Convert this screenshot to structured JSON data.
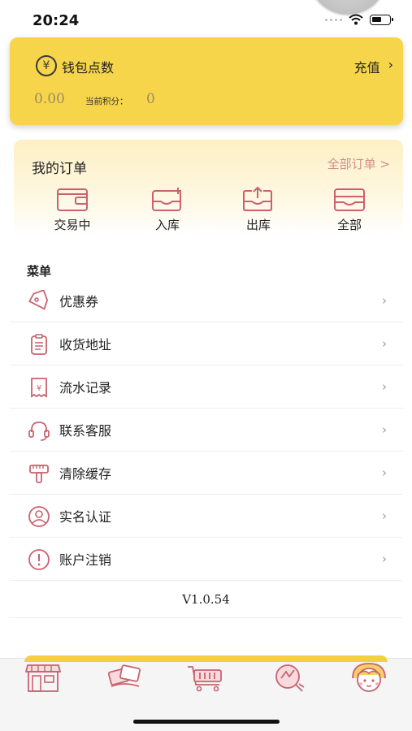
{
  "status_bar": {
    "time": "20:24"
  },
  "wallet": {
    "icon": "yen-coin-icon",
    "title": "钱包点数",
    "recharge_label": "充值",
    "balance": "0.00",
    "points_label": "当前积分：",
    "points_value": "0",
    "accent_color": "#f7d54a"
  },
  "orders": {
    "title": "我的订单",
    "all_orders_label": "全部订单 >",
    "items": [
      {
        "label": "交易中",
        "icon": "wallet-icon"
      },
      {
        "label": "入库",
        "icon": "inbox-in-icon"
      },
      {
        "label": "出库",
        "icon": "inbox-out-icon"
      },
      {
        "label": "全部",
        "icon": "inbox-all-icon"
      }
    ],
    "icon_color": "#c9626e"
  },
  "menu": {
    "title": "菜单",
    "items": [
      {
        "label": "优惠券",
        "icon": "tag-icon"
      },
      {
        "label": "收货地址",
        "icon": "clipboard-icon"
      },
      {
        "label": "流水记录",
        "icon": "receipt-icon"
      },
      {
        "label": "联系客服",
        "icon": "headset-icon"
      },
      {
        "label": "清除缓存",
        "icon": "brush-icon"
      },
      {
        "label": "实名认证",
        "icon": "user-verify-icon"
      },
      {
        "label": "账户注销",
        "icon": "alert-icon"
      }
    ],
    "chevron": "›"
  },
  "version": "V1.0.54",
  "tabbar": {
    "items": [
      {
        "icon": "shop-icon"
      },
      {
        "icon": "cards-icon"
      },
      {
        "icon": "cart-icon"
      },
      {
        "icon": "gift-icon"
      },
      {
        "icon": "character-avatar-icon"
      }
    ]
  }
}
